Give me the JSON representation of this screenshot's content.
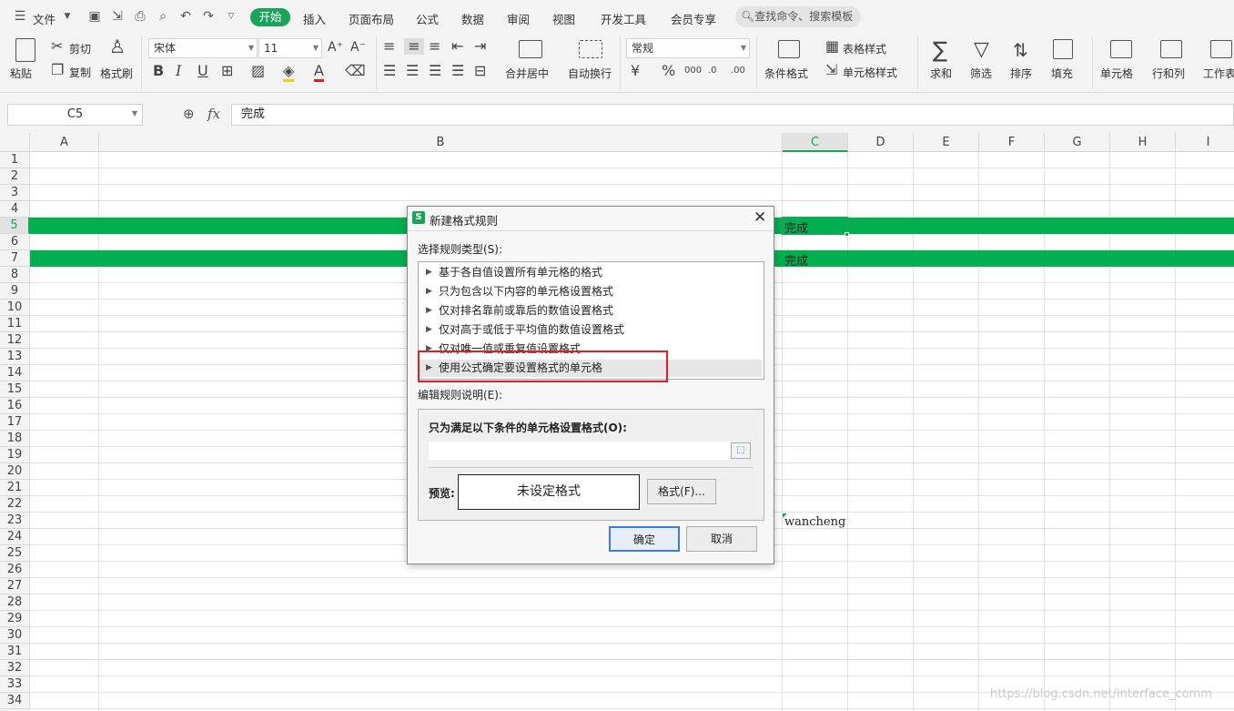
{
  "menubar": {
    "file_label": "文件",
    "tabs": [
      "开始",
      "插入",
      "页面布局",
      "公式",
      "数据",
      "审阅",
      "视图",
      "开发工具",
      "会员专享"
    ],
    "search_placeholder": "查找命令、搜索模板"
  },
  "ribbon": {
    "paste": "粘贴",
    "cut": "剪切",
    "copy": "复制",
    "format_painter": "格式刷",
    "font_name": "宋体",
    "font_size": "11",
    "merge_center": "合并居中",
    "wrap_text": "自动换行",
    "number_format": "常规",
    "conditional_format": "条件格式",
    "table_style": "表格样式",
    "cell_style": "单元格样式",
    "sum": "求和",
    "filter": "筛选",
    "sort": "排序",
    "fill": "填充",
    "cell": "单元格",
    "row_col": "行和列",
    "worksheet": "工作表"
  },
  "formula_bar": {
    "name_box": "C5",
    "fx": "fx",
    "value": "完成"
  },
  "grid": {
    "columns": [
      "A",
      "B",
      "C",
      "D",
      "E",
      "F",
      "G",
      "H",
      "I"
    ],
    "rows": [
      "1",
      "2",
      "3",
      "4",
      "5",
      "6",
      "7",
      "8",
      "9",
      "10",
      "11",
      "12",
      "13",
      "14",
      "15",
      "16",
      "17",
      "18",
      "19",
      "20",
      "21",
      "22",
      "23",
      "24",
      "25",
      "26",
      "27",
      "28",
      "29",
      "30",
      "31",
      "32",
      "33",
      "34"
    ],
    "c5": "完成",
    "c7": "完成",
    "c23": "wancheng"
  },
  "dialog": {
    "title": "新建格式规则",
    "select_type_label": "选择规则类型(S):",
    "rule_types": [
      "基于各自值设置所有单元格的格式",
      "只为包含以下内容的单元格设置格式",
      "仅对排名靠前或靠后的数值设置格式",
      "仅对高于或低于平均值的数值设置格式",
      "仅对唯一值或重复值设置格式",
      "使用公式确定要设置格式的单元格"
    ],
    "edit_desc_label": "编辑规则说明(E):",
    "condition_label": "只为满足以下条件的单元格设置格式(O):",
    "formula_value": "",
    "preview_label": "预览:",
    "preview_text": "未设定格式",
    "format_button": "格式(F)...",
    "ok_button": "确定",
    "cancel_button": "取消"
  },
  "watermark": "https://blog.csdn.net/interface_comm",
  "colors": {
    "accent_green": "#1aa35b",
    "row_highlight": "#00b050",
    "callout_red": "#e02020"
  }
}
